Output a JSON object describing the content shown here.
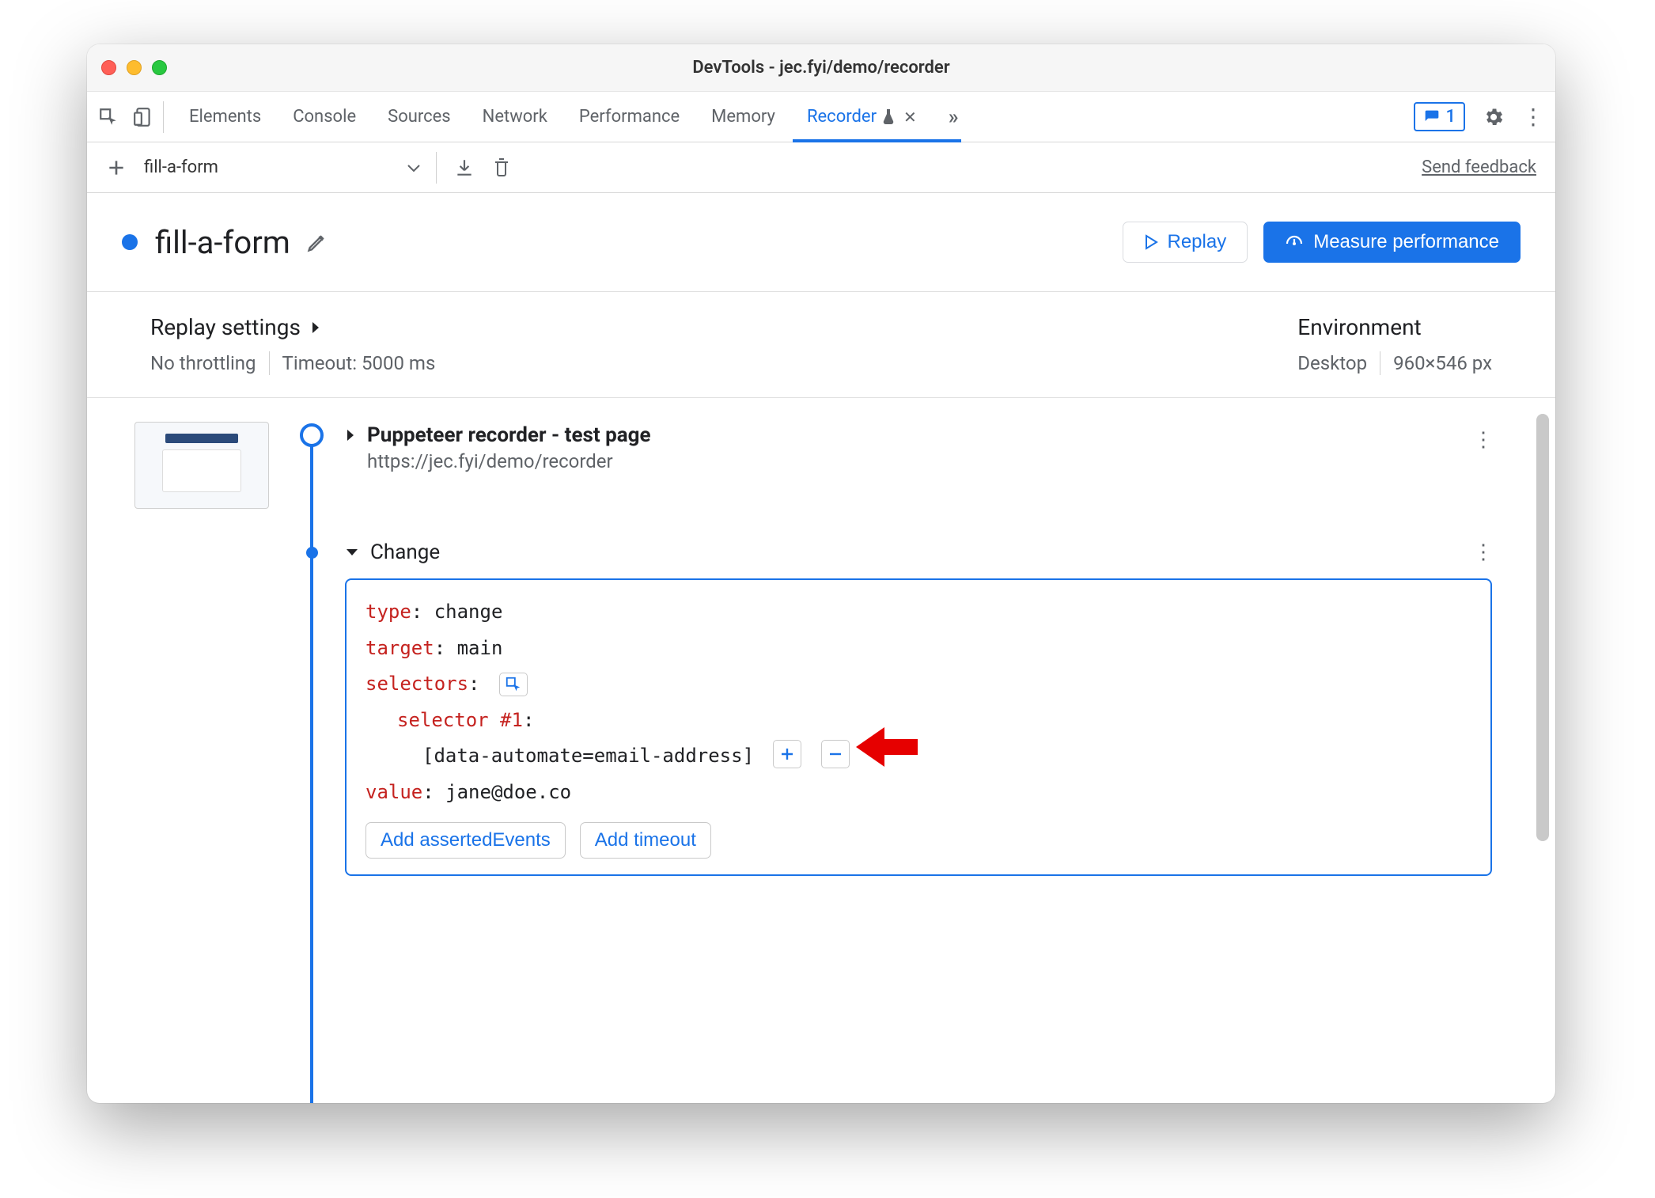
{
  "window": {
    "title": "DevTools - jec.fyi/demo/recorder"
  },
  "tabs": {
    "items": [
      "Elements",
      "Console",
      "Sources",
      "Network",
      "Performance",
      "Memory",
      "Recorder"
    ],
    "active": "Recorder",
    "badge_count": "1"
  },
  "toolbar": {
    "recording_name": "fill-a-form",
    "feedback": "Send feedback"
  },
  "header": {
    "title": "fill-a-form",
    "replay_btn": "Replay",
    "measure_btn": "Measure performance"
  },
  "settings": {
    "replay_title": "Replay settings",
    "throttling": "No throttling",
    "timeout": "Timeout: 5000 ms",
    "env_title": "Environment",
    "env_device": "Desktop",
    "env_dims": "960×546 px"
  },
  "steps": {
    "step1_title": "Puppeteer recorder - test page",
    "step1_url": "https://jec.fyi/demo/recorder",
    "step2_title": "Change",
    "change": {
      "type_k": "type",
      "type_v": "change",
      "target_k": "target",
      "target_v": "main",
      "selectors_k": "selectors",
      "selector1_k": "selector #1",
      "selector1_v": "[data-automate=email-address]",
      "value_k": "value",
      "value_v": "jane@doe.co",
      "add_asserted": "Add assertedEvents",
      "add_timeout": "Add timeout"
    }
  }
}
